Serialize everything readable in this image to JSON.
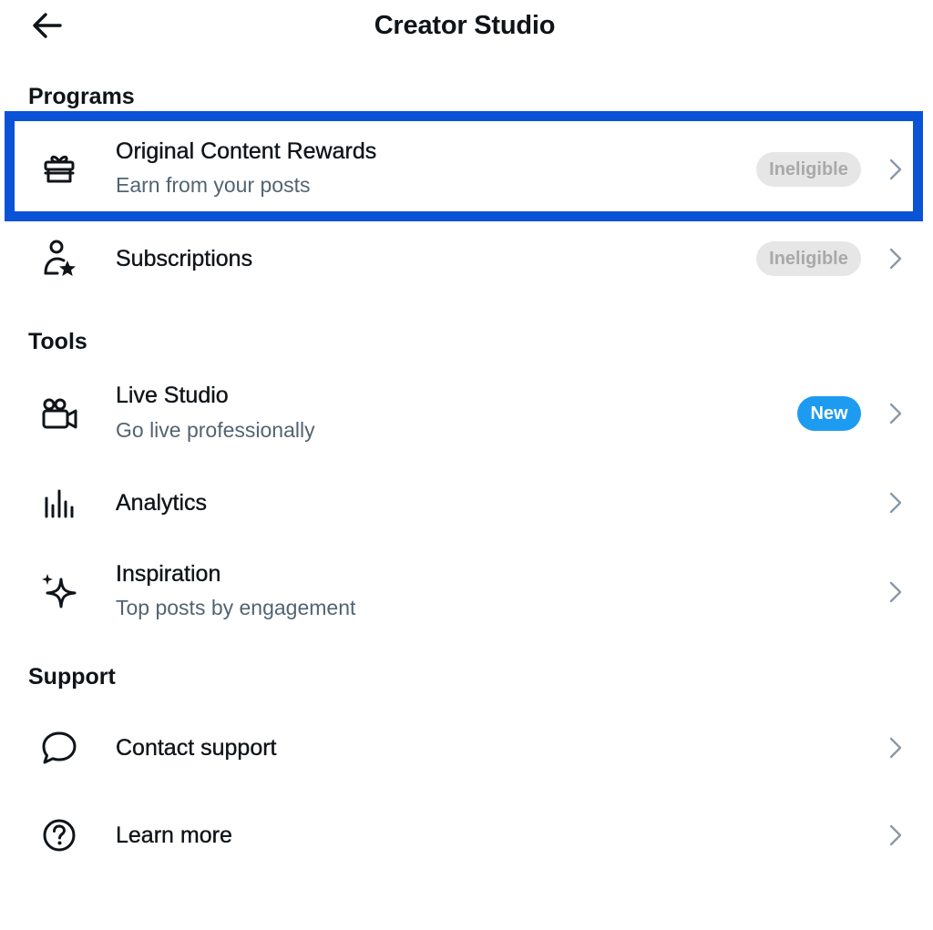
{
  "header": {
    "title": "Creator Studio",
    "back_icon": "arrow-left-icon"
  },
  "sections": {
    "programs": "Programs",
    "tools": "Tools",
    "support": "Support"
  },
  "programs": [
    {
      "title": "Original Content Rewards",
      "subtitle": "Earn from your posts",
      "badge": "Ineligible",
      "icon": "gift-icon"
    },
    {
      "title": "Subscriptions",
      "badge": "Ineligible",
      "icon": "person-star-icon"
    }
  ],
  "tools": [
    {
      "title": "Live Studio",
      "subtitle": "Go live professionally",
      "badge": "New",
      "icon": "video-camera-icon"
    },
    {
      "title": "Analytics",
      "icon": "bar-chart-icon"
    },
    {
      "title": "Inspiration",
      "subtitle": "Top posts by engagement",
      "icon": "sparkle-icon"
    }
  ],
  "support": [
    {
      "title": "Contact support",
      "icon": "chat-bubble-icon"
    },
    {
      "title": "Learn more",
      "icon": "question-circle-icon"
    }
  ],
  "colors": {
    "text": "#0f1419",
    "subtext": "#536471",
    "ineligible_bg": "#e6e6e6",
    "ineligible_text": "#a9a9a9",
    "new_badge": "#1d9bf0",
    "highlight": "#0a52d6"
  }
}
